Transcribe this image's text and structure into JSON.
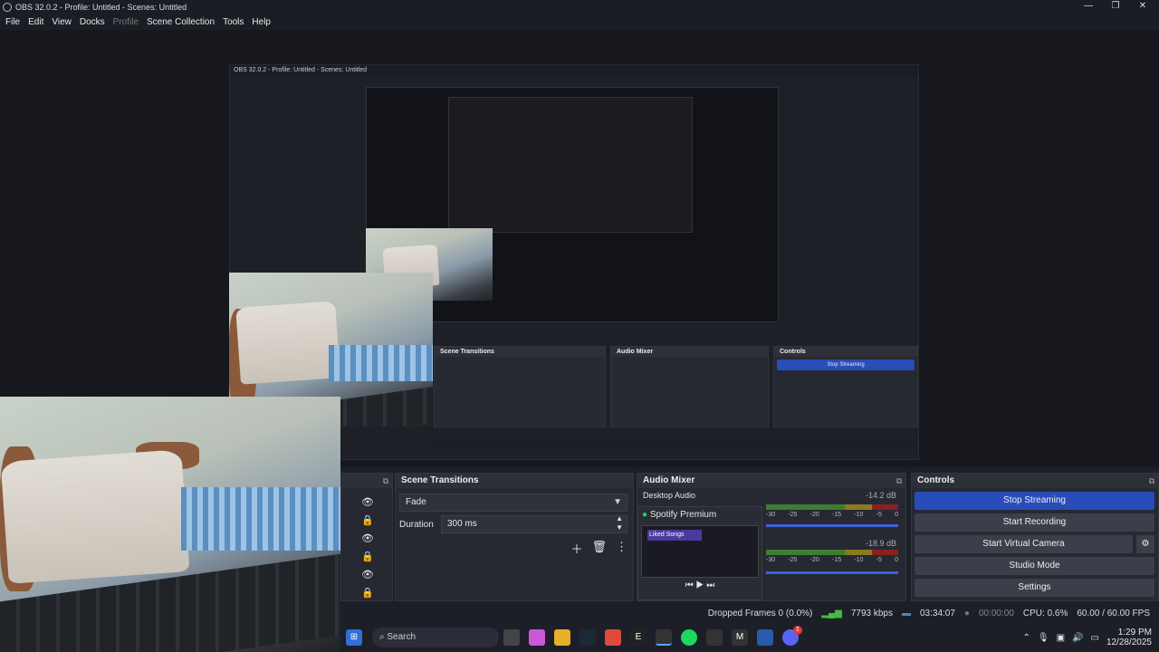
{
  "window": {
    "title": "OBS 32.0.2 - Profile: Untitled - Scenes: Untitled"
  },
  "menu": {
    "items": [
      "File",
      "Edit",
      "View",
      "Docks",
      "Profile",
      "Scene Collection",
      "Tools",
      "Help"
    ],
    "disabled": [
      "Profile"
    ]
  },
  "nested": {
    "title": "OBS 32.0.2 - Profile: Untitled - Scenes: Untitled"
  },
  "sources": {
    "rows": 4
  },
  "transitions": {
    "title": "Scene Transitions",
    "transition": "Fade",
    "duration_label": "Duration",
    "duration_value": "300 ms"
  },
  "mixer": {
    "title": "Audio Mixer",
    "desktop_label": "Desktop Audio",
    "desktop_db": "-14.2 dB",
    "spotify_label": "Spotify Premium",
    "spotify_db": "-18.9 dB",
    "spotify_card_text": "Liked Songs",
    "ticks": [
      "-30",
      "-25",
      "-20",
      "-15",
      "-10",
      "-5",
      "0"
    ]
  },
  "controls": {
    "title": "Controls",
    "stop_streaming": "Stop Streaming",
    "start_recording": "Start Recording",
    "start_virtual_camera": "Start Virtual Camera",
    "studio_mode": "Studio Mode",
    "settings": "Settings"
  },
  "status": {
    "dropped": "Dropped Frames 0 (0.0%)",
    "kbps": "7793 kbps",
    "stream_time": "03:34:07",
    "rec_time": "00:00:00",
    "cpu": "CPU: 0.6%",
    "fps": "60.00 / 60.00 FPS"
  },
  "taskbar": {
    "search": "Search",
    "time": "1:29 PM",
    "date": "12/28/2025",
    "badge": "1"
  },
  "colors": {
    "accent": "#284cb8",
    "panel": "#262932",
    "bg": "#1d1f26"
  }
}
